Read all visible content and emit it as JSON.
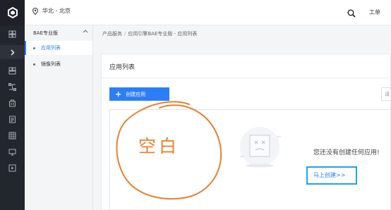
{
  "header": {
    "region": "华北 - 北京",
    "ticket_label": "工单"
  },
  "rail": {
    "items": [
      "dashboard-icon",
      "expand-icon",
      "grid-icon",
      "network-icon",
      "building-icon",
      "document-icon",
      "table-icon",
      "monitor-icon",
      "play-icon"
    ]
  },
  "subnav": {
    "title": "BAE专业版",
    "items": [
      {
        "label": "应用列表",
        "active": true
      },
      {
        "label": "镜像列表",
        "active": false
      }
    ]
  },
  "breadcrumb": [
    "产品服务",
    "应用引擎BAE专业版 - 应用列表"
  ],
  "card": {
    "title": "应用列表",
    "create_button": "创建应用",
    "right_stub": "请"
  },
  "empty_state": {
    "message": "您还没有创建任何应用!",
    "link": "马上创建>>"
  },
  "annotation": {
    "text": "空白",
    "color": "#e8812e"
  },
  "colors": {
    "accent": "#2c7ef8",
    "highlight_box": "#20a3e6"
  }
}
